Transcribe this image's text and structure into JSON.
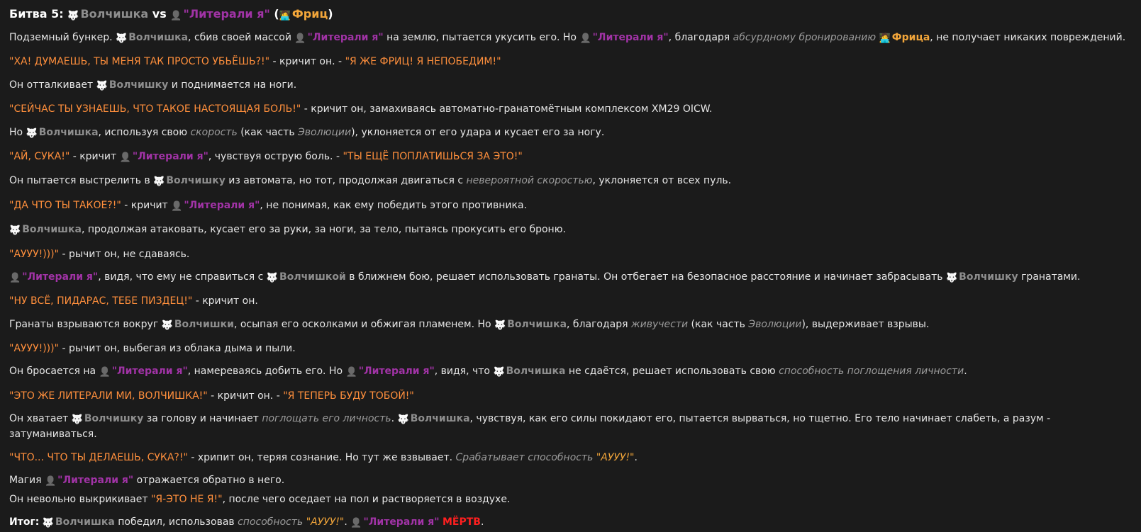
{
  "colors": {
    "background": "#1b1b1b",
    "text": "#e6e6e6",
    "wolf_name": "#8e8e8e",
    "literali_name": "#a133a6",
    "fritz_name": "#f3a63a",
    "speech": "#ff8f3c",
    "italic_note": "#9b9b9b",
    "dead": "#ff1f1f"
  },
  "icons": {
    "wolf": "wolf-face-icon",
    "literali": "bust-silhouette-icon",
    "fritz": "technologist-icon"
  },
  "lines": [
    {
      "kind": "title",
      "segs": [
        {
          "c": "b",
          "t": "Битва 5:"
        },
        {
          "c": "",
          "t": " "
        },
        {
          "ico": "wolf"
        },
        {
          "c": "g",
          "t": "Волчишка"
        },
        {
          "c": "b",
          "t": " vs "
        },
        {
          "ico": "bust"
        },
        {
          "c": "p",
          "t": "\"Литерали я\""
        },
        {
          "c": "b",
          "t": " ("
        },
        {
          "ico": "fritz"
        },
        {
          "c": "o",
          "t": "Фриц"
        },
        {
          "c": "b",
          "t": ")"
        }
      ]
    },
    {
      "segs": [
        {
          "c": "",
          "t": "Подземный бункер. "
        },
        {
          "ico": "wolf"
        },
        {
          "c": "g",
          "t": "Волчишка"
        },
        {
          "c": "",
          "t": ", сбив своей массой "
        },
        {
          "ico": "bust"
        },
        {
          "c": "p",
          "t": "\"Литерали я\""
        },
        {
          "c": "",
          "t": " на землю, пытается укусить его. Но "
        },
        {
          "ico": "bust"
        },
        {
          "c": "p",
          "t": "\"Литерали я\""
        },
        {
          "c": "",
          "t": ", благодаря "
        },
        {
          "c": "i",
          "t": "абсурдному бронированию"
        },
        {
          "c": "",
          "t": " "
        },
        {
          "ico": "fritz"
        },
        {
          "c": "o",
          "t": "Фрица"
        },
        {
          "c": "",
          "t": ", не получает никаких повреждений."
        }
      ]
    },
    {
      "segs": [
        {
          "c": "q",
          "t": "\"ХА! ДУМАЕШЬ, ТЫ МЕНЯ ТАК ПРОСТО УБЬЁШЬ?!\""
        },
        {
          "c": "",
          "t": " - кричит он. - "
        },
        {
          "c": "q",
          "t": "\"Я ЖЕ ФРИЦ! Я НЕПОБЕДИМ!\""
        }
      ]
    },
    {
      "segs": [
        {
          "c": "",
          "t": "Он отталкивает "
        },
        {
          "ico": "wolf"
        },
        {
          "c": "g",
          "t": "Волчишку"
        },
        {
          "c": "",
          "t": " и поднимается на ноги."
        }
      ]
    },
    {
      "segs": [
        {
          "c": "q",
          "t": "\"СЕЙЧАС ТЫ УЗНАЕШЬ, ЧТО ТАКОЕ НАСТОЯЩАЯ БОЛЬ!\""
        },
        {
          "c": "",
          "t": " - кричит он, замахиваясь автоматно-гранатомётным комплексом XM29 OICW."
        }
      ]
    },
    {
      "segs": [
        {
          "c": "",
          "t": "Но "
        },
        {
          "ico": "wolf"
        },
        {
          "c": "g",
          "t": "Волчишка"
        },
        {
          "c": "",
          "t": ", используя свою "
        },
        {
          "c": "i",
          "t": "скорость"
        },
        {
          "c": "",
          "t": " (как часть "
        },
        {
          "c": "i",
          "t": "Эволюции"
        },
        {
          "c": "",
          "t": "), уклоняется от его удара и кусает его за ногу."
        }
      ]
    },
    {
      "segs": [
        {
          "c": "q",
          "t": "\"АЙ, СУКА!\""
        },
        {
          "c": "",
          "t": " - кричит "
        },
        {
          "ico": "bust"
        },
        {
          "c": "p",
          "t": "\"Литерали я\""
        },
        {
          "c": "",
          "t": ", чувствуя острую боль. - "
        },
        {
          "c": "q",
          "t": "\"ТЫ ЕЩЁ ПОПЛАТИШЬСЯ ЗА ЭТО!\""
        }
      ]
    },
    {
      "segs": [
        {
          "c": "",
          "t": "Он пытается выстрелить в "
        },
        {
          "ico": "wolf"
        },
        {
          "c": "g",
          "t": "Волчишку"
        },
        {
          "c": "",
          "t": " из автомата, но тот, продолжая двигаться с "
        },
        {
          "c": "i",
          "t": "невероятной скоростью"
        },
        {
          "c": "",
          "t": ", уклоняется от всех пуль."
        }
      ]
    },
    {
      "segs": [
        {
          "c": "q",
          "t": "\"ДА ЧТО ТЫ ТАКОЕ?!\""
        },
        {
          "c": "",
          "t": " - кричит "
        },
        {
          "ico": "bust"
        },
        {
          "c": "p",
          "t": "\"Литерали я\""
        },
        {
          "c": "",
          "t": ", не понимая, как ему победить этого противника."
        }
      ]
    },
    {
      "segs": [
        {
          "ico": "wolf"
        },
        {
          "c": "g",
          "t": "Волчишка"
        },
        {
          "c": "",
          "t": ", продолжая атаковать, кусает его за руки, за ноги, за тело, пытаясь прокусить его броню."
        }
      ]
    },
    {
      "segs": [
        {
          "c": "q",
          "t": "\"АУУУ!)))\""
        },
        {
          "c": "",
          "t": " - рычит он, не сдаваясь."
        }
      ]
    },
    {
      "segs": [
        {
          "ico": "bust"
        },
        {
          "c": "p",
          "t": "\"Литерали я\""
        },
        {
          "c": "",
          "t": ", видя, что ему не справиться с "
        },
        {
          "ico": "wolf"
        },
        {
          "c": "g",
          "t": "Волчишкой"
        },
        {
          "c": "",
          "t": " в ближнем бою, решает использовать гранаты. Он отбегает на безопасное расстояние и начинает забрасывать "
        },
        {
          "ico": "wolf"
        },
        {
          "c": "g",
          "t": "Волчишку"
        },
        {
          "c": "",
          "t": " гранатами."
        }
      ]
    },
    {
      "segs": [
        {
          "c": "q",
          "t": "\"НУ ВСЁ, ПИДАРАС, ТЕБЕ ПИЗДЕЦ!\""
        },
        {
          "c": "",
          "t": " - кричит он."
        }
      ]
    },
    {
      "segs": [
        {
          "c": "",
          "t": "Гранаты взрываются вокруг "
        },
        {
          "ico": "wolf"
        },
        {
          "c": "g",
          "t": "Волчишки"
        },
        {
          "c": "",
          "t": ", осыпая его осколками и обжигая пламенем. Но "
        },
        {
          "ico": "wolf"
        },
        {
          "c": "g",
          "t": "Волчишка"
        },
        {
          "c": "",
          "t": ", благодаря "
        },
        {
          "c": "i",
          "t": "живучести"
        },
        {
          "c": "",
          "t": " (как часть "
        },
        {
          "c": "i",
          "t": "Эволюции"
        },
        {
          "c": "",
          "t": "), выдерживает взрывы."
        }
      ]
    },
    {
      "segs": [
        {
          "c": "q",
          "t": "\"АУУУ!)))\""
        },
        {
          "c": "",
          "t": " - рычит он, выбегая из облака дыма и пыли."
        }
      ]
    },
    {
      "segs": [
        {
          "c": "",
          "t": "Он бросается на "
        },
        {
          "ico": "bust"
        },
        {
          "c": "p",
          "t": "\"Литерали я\""
        },
        {
          "c": "",
          "t": ", намереваясь добить его. Но "
        },
        {
          "ico": "bust"
        },
        {
          "c": "p",
          "t": "\"Литерали я\""
        },
        {
          "c": "",
          "t": ", видя, что "
        },
        {
          "ico": "wolf"
        },
        {
          "c": "g",
          "t": "Волчишка"
        },
        {
          "c": "",
          "t": " не сдаётся, решает использовать свою "
        },
        {
          "c": "i",
          "t": "способность поглощения личности"
        },
        {
          "c": "",
          "t": "."
        }
      ]
    },
    {
      "segs": [
        {
          "c": "q",
          "t": "\"ЭТО ЖЕ ЛИТЕРАЛИ МИ, ВОЛЧИШКА!\""
        },
        {
          "c": "",
          "t": " - кричит он. - "
        },
        {
          "c": "q",
          "t": "\"Я ТЕПЕРЬ БУДУ ТОБОЙ!\""
        }
      ]
    },
    {
      "segs": [
        {
          "c": "",
          "t": "Он хватает "
        },
        {
          "ico": "wolf"
        },
        {
          "c": "g",
          "t": "Волчишку"
        },
        {
          "c": "",
          "t": " за голову и начинает "
        },
        {
          "c": "i",
          "t": "поглощать его личность"
        },
        {
          "c": "",
          "t": ". "
        },
        {
          "ico": "wolf"
        },
        {
          "c": "g",
          "t": "Волчишка"
        },
        {
          "c": "",
          "t": ", чувствуя, как его силы покидают его, пытается вырваться, но тщетно. Его тело начинает слабеть, а разум - затуманиваться."
        }
      ]
    },
    {
      "segs": [
        {
          "c": "q",
          "t": "\"ЧТО... ЧТО ТЫ ДЕЛАЕШЬ, СУКА?!\""
        },
        {
          "c": "",
          "t": " - хрипит он, теряя сознание. Но тут же взвывает. "
        },
        {
          "c": "i",
          "t": "Срабатывает способность "
        },
        {
          "c": "iq",
          "t": "\"АУУУ!\""
        },
        {
          "c": "",
          "t": "."
        }
      ]
    },
    {
      "kind": "tight",
      "segs": [
        {
          "c": "",
          "t": "Магия "
        },
        {
          "ico": "bust"
        },
        {
          "c": "p",
          "t": "\"Литерали я\""
        },
        {
          "c": "",
          "t": " отражается обратно в него."
        }
      ]
    },
    {
      "segs": [
        {
          "c": "",
          "t": "Он невольно выкрикивает "
        },
        {
          "c": "q",
          "t": "\"Я-ЭТО НЕ Я!\""
        },
        {
          "c": "",
          "t": ", после чего оседает на пол и растворяется в воздухе."
        }
      ]
    },
    {
      "segs": [
        {
          "c": "b",
          "t": "Итог:"
        },
        {
          "c": "",
          "t": " "
        },
        {
          "ico": "wolf"
        },
        {
          "c": "g",
          "t": "Волчишка"
        },
        {
          "c": "",
          "t": " победил, использовав "
        },
        {
          "c": "i",
          "t": "способность "
        },
        {
          "c": "iq",
          "t": "\"АУУУ!\""
        },
        {
          "c": "",
          "t": ". "
        },
        {
          "ico": "bust"
        },
        {
          "c": "p",
          "t": "\"Литерали я\""
        },
        {
          "c": "",
          "t": " "
        },
        {
          "c": "r",
          "t": "МЁРТВ"
        },
        {
          "c": "",
          "t": "."
        }
      ]
    }
  ]
}
